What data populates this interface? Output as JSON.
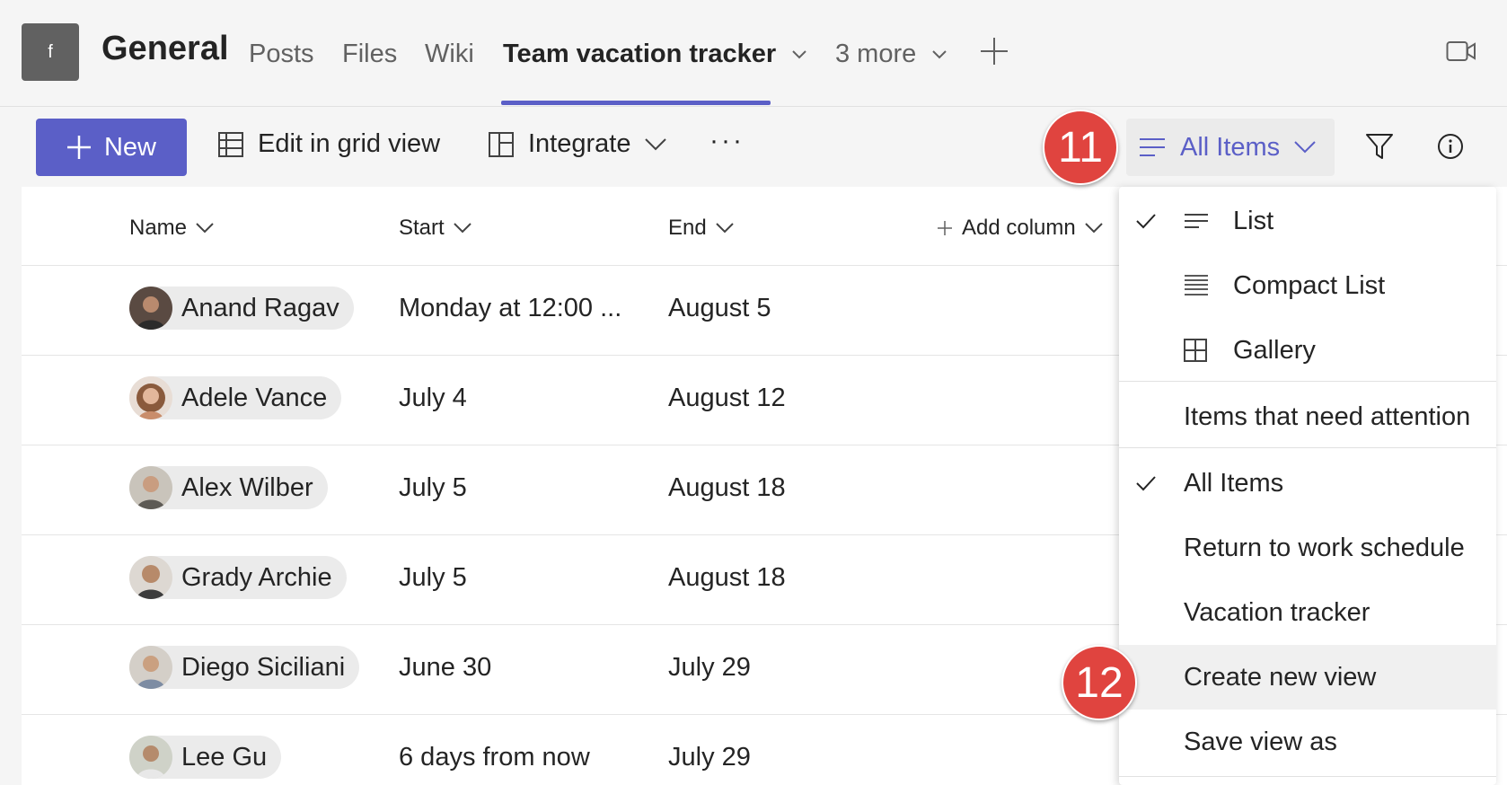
{
  "header": {
    "team_initial": "f",
    "channel": "General",
    "tabs": [
      "Posts",
      "Files",
      "Wiki",
      "Team vacation tracker",
      "3 more"
    ]
  },
  "toolbar": {
    "new_label": "New",
    "edit_grid_label": "Edit in grid view",
    "integrate_label": "Integrate",
    "more_label": "···",
    "view_label": "All Items"
  },
  "badges": {
    "step_a": "11",
    "step_b": "12"
  },
  "table": {
    "columns": [
      "Name",
      "Start",
      "End",
      "Add column"
    ],
    "rows": [
      {
        "name": "Anand Ragav",
        "start": "Monday at 12:00 ...",
        "end": "August 5"
      },
      {
        "name": "Adele Vance",
        "start": "July 4",
        "end": "August 12"
      },
      {
        "name": "Alex Wilber",
        "start": "July 5",
        "end": "August 18"
      },
      {
        "name": "Grady Archie",
        "start": "July 5",
        "end": "August 18"
      },
      {
        "name": "Diego Siciliani",
        "start": "June 30",
        "end": "July 29"
      },
      {
        "name": "Lee Gu",
        "start": "6 days from now",
        "end": "July 29"
      }
    ]
  },
  "dropdown": {
    "layouts": [
      "List",
      "Compact List",
      "Gallery"
    ],
    "attention": "Items that need attention",
    "views": [
      "All Items",
      "Return to work schedule",
      "Vacation tracker"
    ],
    "actions": [
      "Create new view",
      "Save view as"
    ]
  },
  "colors": {
    "accent": "#5b5fc7",
    "badge": "#e0443f"
  }
}
